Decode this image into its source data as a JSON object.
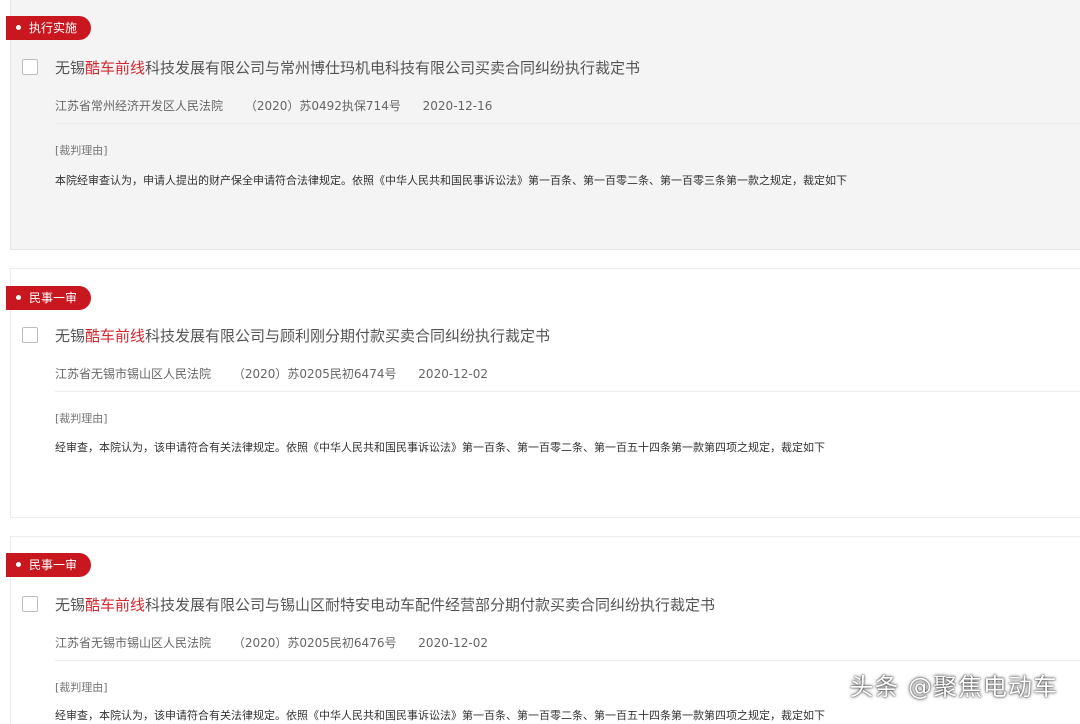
{
  "colors": {
    "accent": "#c8171e",
    "highlight": "#d7282f"
  },
  "results": [
    {
      "tag": "执行实施",
      "title_highlight": "酷车前线",
      "title_prefix": "无锡",
      "title_suffix": "科技发展有限公司与常州博仕玛机电科技有限公司买卖合同纠纷执行裁定书",
      "court": "江苏省常州经济开发区人民法院",
      "case_no": "（2020）苏0492执保714号",
      "date": "2020-12-16",
      "reason_label": "[裁判理由]",
      "reason_text": "本院经审查认为，申请人提出的财产保全申请符合法律规定。依照《中华人民共和国民事诉讼法》第一百条、第一百零二条、第一百零三条第一款之规定，裁定如下"
    },
    {
      "tag": "民事一审",
      "title_highlight": "酷车前线",
      "title_prefix": "无锡",
      "title_suffix": "科技发展有限公司与顾利刚分期付款买卖合同纠纷执行裁定书",
      "court": "江苏省无锡市锡山区人民法院",
      "case_no": "（2020）苏0205民初6474号",
      "date": "2020-12-02",
      "reason_label": "[裁判理由]",
      "reason_text": "经审查，本院认为，该申请符合有关法律规定。依照《中华人民共和国民事诉讼法》第一百条、第一百零二条、第一百五十四条第一款第四项之规定，裁定如下"
    },
    {
      "tag": "民事一审",
      "title_highlight": "酷车前线",
      "title_prefix": "无锡",
      "title_suffix": "科技发展有限公司与锡山区耐特安电动车配件经营部分期付款买卖合同纠纷执行裁定书",
      "court": "江苏省无锡市锡山区人民法院",
      "case_no": "（2020）苏0205民初6476号",
      "date": "2020-12-02",
      "reason_label": "[裁判理由]",
      "reason_text": "经审查，本院认为，该申请符合有关法律规定。依照《中华人民共和国民事诉讼法》第一百条、第一百零二条、第一百五十四条第一款第四项之规定，裁定如下"
    }
  ],
  "watermark": "头条 @聚焦电动车"
}
